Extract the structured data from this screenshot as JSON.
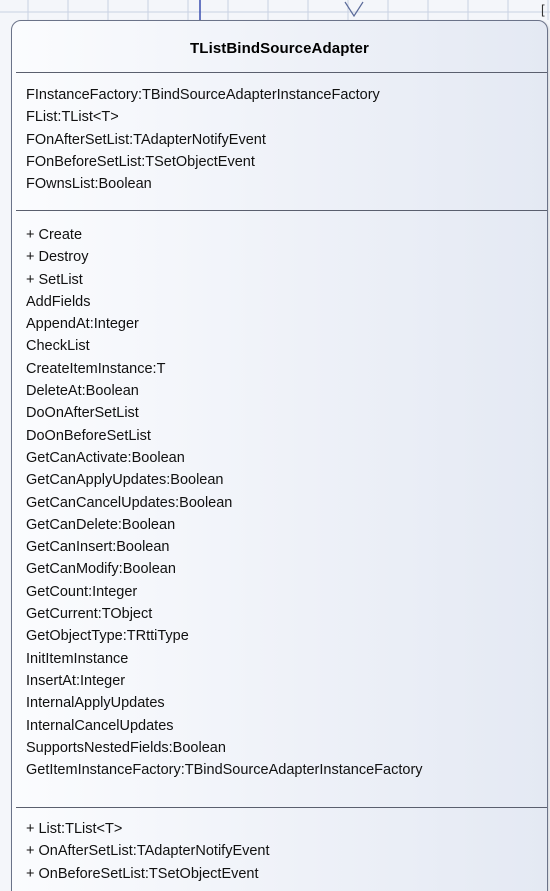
{
  "class": {
    "name": "TListBindSourceAdapter",
    "fields": [
      "FInstanceFactory:TBindSourceAdapterInstanceFactory",
      "FList:TList<T>",
      "FOnAfterSetList:TAdapterNotifyEvent",
      "FOnBeforeSetList:TSetObjectEvent",
      "FOwnsList:Boolean"
    ],
    "methods": [
      "+ Create",
      "+ Destroy",
      "+ SetList",
      "AddFields",
      "AppendAt:Integer",
      "CheckList",
      "CreateItemInstance:T",
      "DeleteAt:Boolean",
      "DoOnAfterSetList",
      "DoOnBeforeSetList",
      "GetCanActivate:Boolean",
      "GetCanApplyUpdates:Boolean",
      "GetCanCancelUpdates:Boolean",
      "GetCanDelete:Boolean",
      "GetCanInsert:Boolean",
      "GetCanModify:Boolean",
      "GetCount:Integer",
      "GetCurrent:TObject",
      "GetObjectType:TRttiType",
      "InitItemInstance",
      "InsertAt:Integer",
      "InternalApplyUpdates",
      "InternalCancelUpdates",
      "SupportsNestedFields:Boolean",
      "GetItemInstanceFactory:TBindSourceAdapterInstanceFactory"
    ],
    "properties": [
      "+ List:TList<T>",
      "+ OnAfterSetList:TAdapterNotifyEvent",
      "+ OnBeforeSetList:TSetObjectEvent"
    ]
  },
  "edge_glyph": "[",
  "colors": {
    "box_border": "#6b7389",
    "box_fill_light": "#fbfcfe",
    "box_fill_dark": "#e4e9f3",
    "divider": "#5a5f6e",
    "grid": "#c9d2e3",
    "connector": "#3a4fb0"
  }
}
